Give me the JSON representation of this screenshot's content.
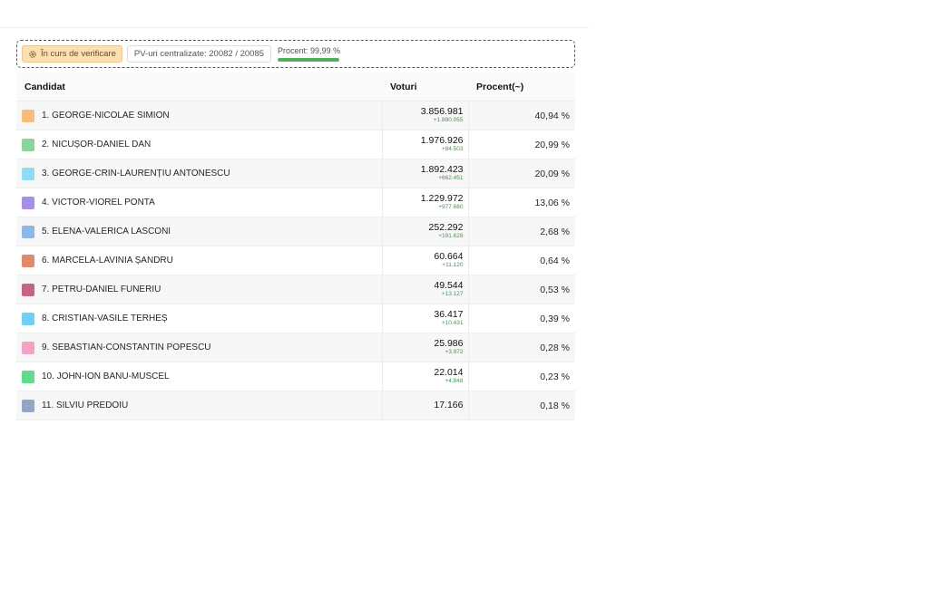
{
  "status": {
    "verification_label": "În curs de verificare",
    "pv_label": "PV-uri centralizate: 20082 / 20085",
    "percent_label": "Procent: 99,99 %",
    "percent_value": 99.99
  },
  "table": {
    "headers": {
      "candidate": "Candidat",
      "votes": "Voturi",
      "percent": "Procent(~)"
    },
    "rows": [
      {
        "name": "1. GEORGE-NICOLAE SIMION",
        "votes": "3.856.981",
        "delta": "+1.880.055",
        "percent": "40,94 %",
        "color": "#f8bd7a"
      },
      {
        "name": "2. NICUȘOR-DANIEL DAN",
        "votes": "1.976.926",
        "delta": "+84.503",
        "percent": "20,99 %",
        "color": "#8ad69a"
      },
      {
        "name": "3. GEORGE-CRIN-LAURENȚIU ANTONESCU",
        "votes": "1.892.423",
        "delta": "+662.451",
        "percent": "20,09 %",
        "color": "#8fdcf3"
      },
      {
        "name": "4. VICTOR-VIOREL PONTA",
        "votes": "1.229.972",
        "delta": "+977.680",
        "percent": "13,06 %",
        "color": "#a890e4"
      },
      {
        "name": "5. ELENA-VALERICA LASCONI",
        "votes": "252.292",
        "delta": "+191.628",
        "percent": "2,68 %",
        "color": "#8fb6e8"
      },
      {
        "name": "6. MARCELA-LAVINIA ȘANDRU",
        "votes": "60.664",
        "delta": "+11.120",
        "percent": "0,64 %",
        "color": "#e08a6a"
      },
      {
        "name": "7. PETRU-DANIEL FUNERIU",
        "votes": "49.544",
        "delta": "+13.127",
        "percent": "0,53 %",
        "color": "#c46386"
      },
      {
        "name": "8. CRISTIAN-VASILE TERHEȘ",
        "votes": "36.417",
        "delta": "+10.431",
        "percent": "0,39 %",
        "color": "#6fd0f3"
      },
      {
        "name": "9. SEBASTIAN-CONSTANTIN POPESCU",
        "votes": "25.986",
        "delta": "+3.972",
        "percent": "0,28 %",
        "color": "#f4a3c8"
      },
      {
        "name": "10. JOHN-ION BANU-MUSCEL",
        "votes": "22.014",
        "delta": "+4.848",
        "percent": "0,23 %",
        "color": "#62dc8c"
      },
      {
        "name": "11. SILVIU PREDOIU",
        "votes": "17.166",
        "delta": "",
        "percent": "0,18 %",
        "color": "#90a8c6"
      }
    ]
  }
}
